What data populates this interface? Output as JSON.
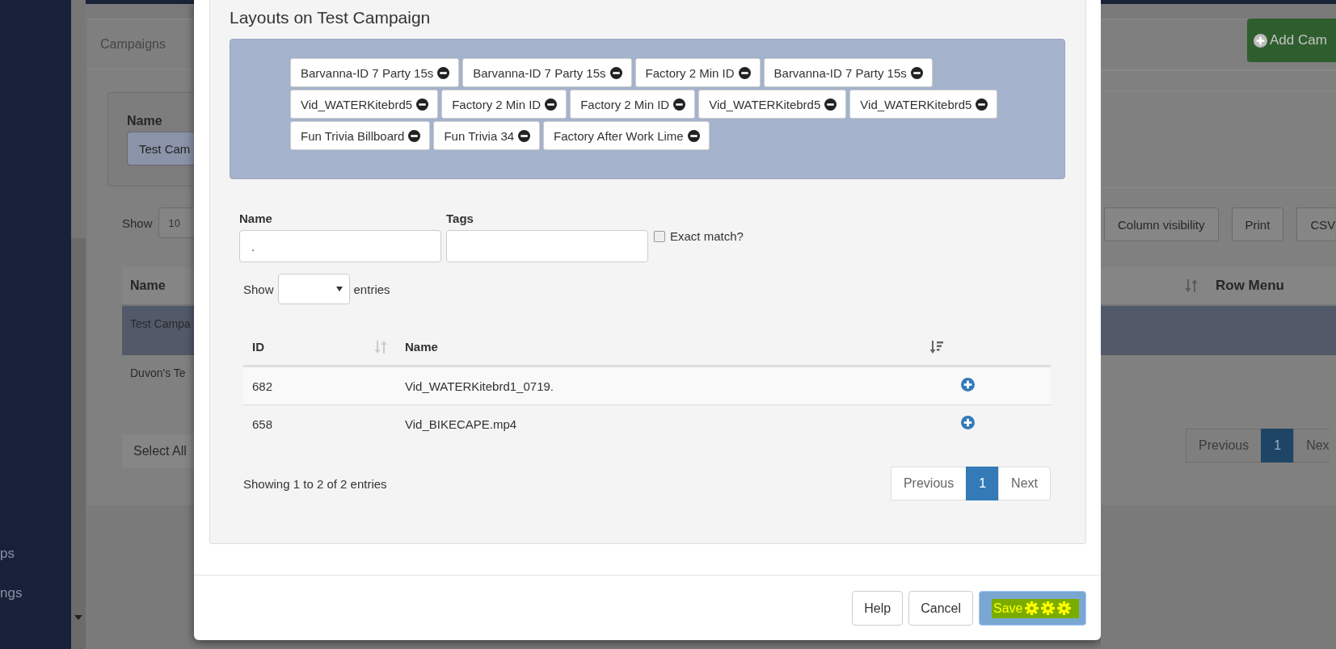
{
  "sidebar": {
    "items": [
      "ps",
      "ngs"
    ]
  },
  "background_left": {
    "heading": "Campaigns",
    "filter_label": "Name",
    "filter_value": "Test Cam",
    "show_label": "Show",
    "show_value": "10",
    "table_header": "Name",
    "rows": [
      {
        "name": "Test Campa",
        "selected": true
      },
      {
        "name": "Duvon's Te",
        "selected": false
      }
    ],
    "select_all": "Select All"
  },
  "background_right": {
    "add_button": "Add Cam",
    "export_buttons": [
      "Column visibility",
      "Print",
      "CSV"
    ],
    "table_header": "Row Menu",
    "pagination": [
      {
        "label": "Previous",
        "selected": false
      },
      {
        "label": "1",
        "selected": true
      },
      {
        "label": "Nex",
        "selected": false
      }
    ]
  },
  "modal": {
    "title": "Layouts on Test Campaign",
    "layout_tags": [
      "Barvanna-ID 7 Party 15s",
      "Barvanna-ID 7 Party 15s",
      "Factory 2 Min ID",
      "Barvanna-ID 7 Party 15s",
      "Vid_WATERKitebrd5",
      "Factory 2 Min ID",
      "Factory 2 Min ID",
      "Vid_WATERKitebrd5",
      "Vid_WATERKitebrd5",
      "Fun Trivia Billboard",
      "Fun Trivia 34",
      "Factory After Work Lime"
    ],
    "search": {
      "name_label": "Name",
      "name_value": ".",
      "tags_label": "Tags",
      "exact_match": {
        "label": "Exact match?",
        "checked": false
      }
    },
    "length": {
      "before": "Show",
      "after": "entries"
    },
    "table": {
      "columns": [
        "ID",
        "Name"
      ],
      "rows": [
        {
          "id": "682",
          "name": "Vid_WATERKitebrd1_0719."
        },
        {
          "id": "658",
          "name": "Vid_BIKECAPE.mp4"
        }
      ]
    },
    "info": "Showing 1 to 2 of 2 entries",
    "pagination": [
      {
        "label": "Previous",
        "selected": false
      },
      {
        "label": "1",
        "selected": true
      },
      {
        "label": "Next",
        "selected": false
      }
    ],
    "buttons": [
      {
        "label": "Help",
        "kind": "default"
      },
      {
        "label": "Cancel",
        "kind": "default"
      },
      {
        "label": "Save",
        "kind": "highlighted"
      }
    ]
  }
}
